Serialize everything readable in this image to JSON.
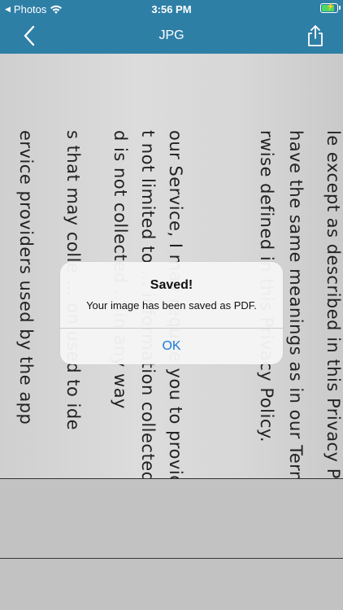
{
  "status_bar": {
    "back_app": "Photos",
    "time": "3:56 PM"
  },
  "nav": {
    "title": "JPG",
    "icons": [
      "chevron-left-icon",
      "share-icon"
    ]
  },
  "document": {
    "lines": [
      "le except as described in this Privacy Poli",
      "have the same meanings as in our Terms",
      "rwise defined in this Privacy Policy.",
      "our Service, I may require you to provide",
      "t not limited to ... information collected",
      "d is not collected ... in any way",
      "s that may colle ... on used to ide",
      "ervice providers used by the app"
    ]
  },
  "alert": {
    "title": "Saved!",
    "message": "Your image has been saved as PDF.",
    "ok_label": "OK"
  },
  "colors": {
    "bar": "#2e7fa6",
    "link": "#1a7ad9",
    "battery": "#4cd964"
  }
}
